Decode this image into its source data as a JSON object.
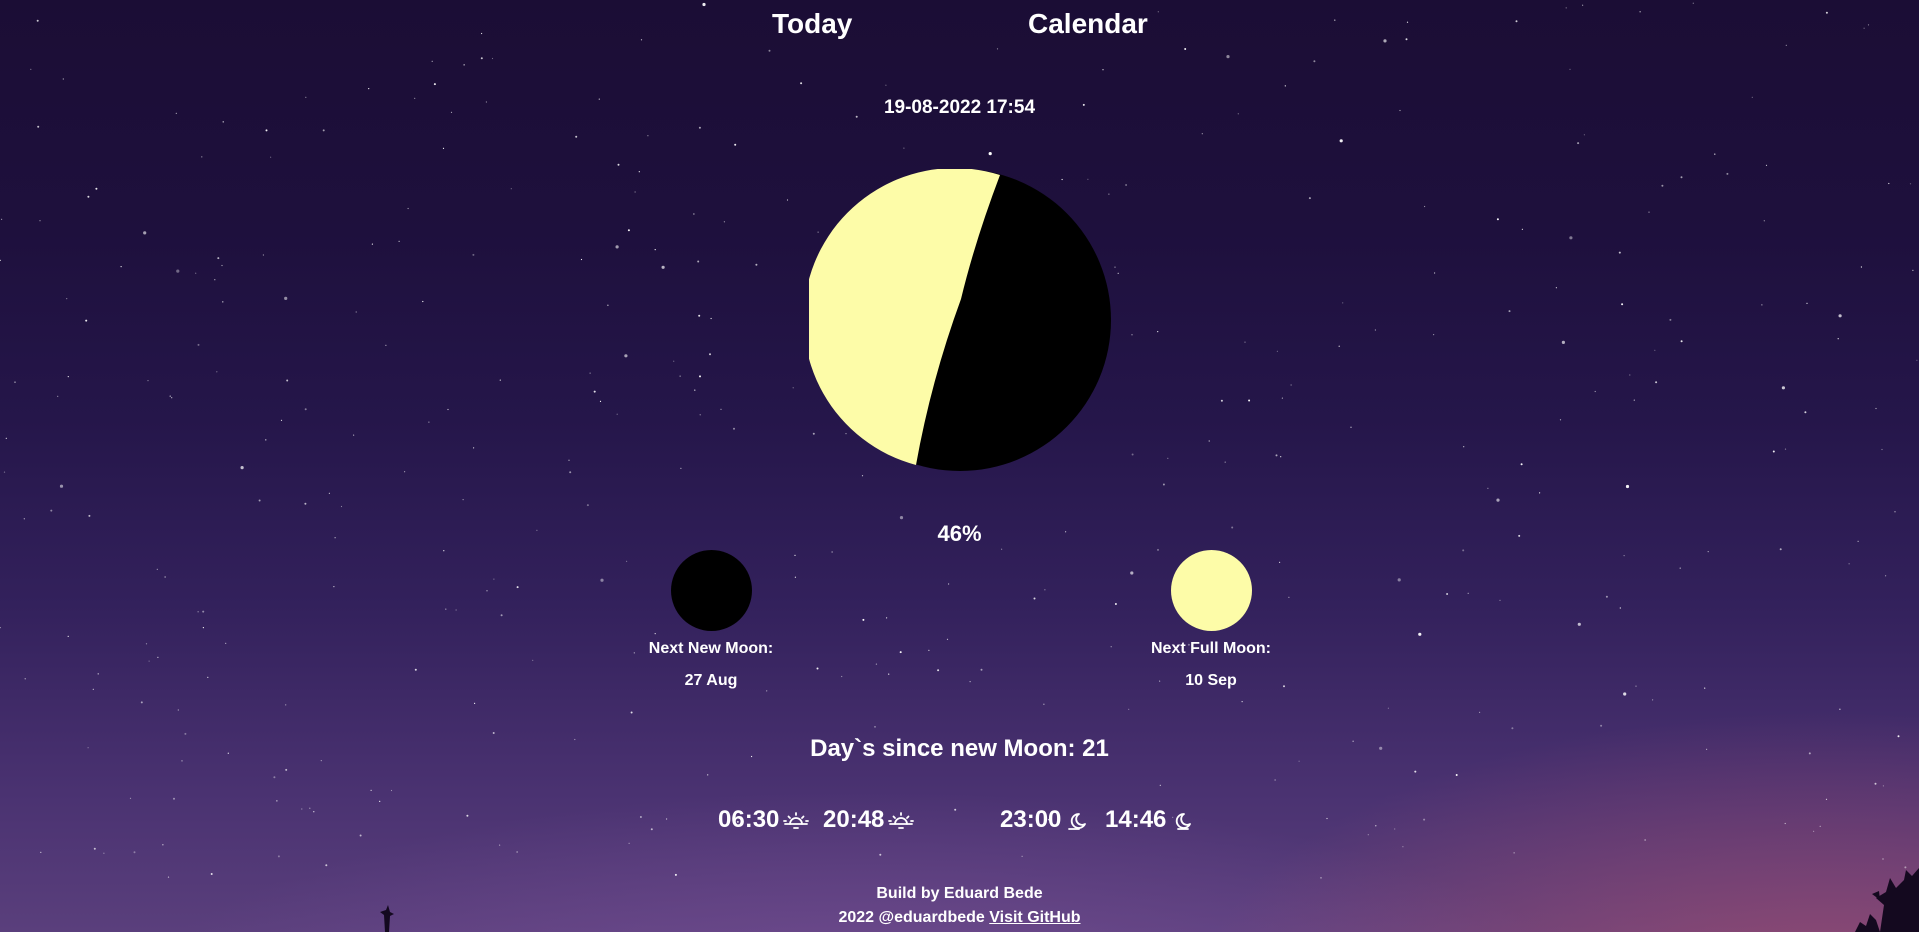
{
  "nav": {
    "today_label": "Today",
    "calendar_label": "Calendar"
  },
  "current": {
    "datetime": "19-08-2022 17:54",
    "illumination": "46%"
  },
  "next_new_moon": {
    "label": "Next New Moon:",
    "date": "27 Aug"
  },
  "next_full_moon": {
    "label": "Next Full Moon:",
    "date": "10 Sep"
  },
  "days_since": {
    "text": "Day`s since new Moon: 21"
  },
  "times": {
    "sunrise": "06:30",
    "sunset": "20:48",
    "moonrise": "23:00",
    "moonset": "14:46"
  },
  "footer": {
    "build_text": "Build by Eduard Bede",
    "copyright_text": "2022 @eduardbede",
    "github_link": "Visit GitHub"
  },
  "icons": {
    "sunrise": "sunrise-icon",
    "sunset": "sunset-icon",
    "moonrise": "moonrise-icon",
    "moonset": "moonset-icon"
  },
  "colors": {
    "moon_lit": "#fdfca8",
    "moon_dark": "#000000",
    "sky_top": "#1b0d35",
    "sky_bottom": "#5a3f7c",
    "text": "#ffffff"
  }
}
